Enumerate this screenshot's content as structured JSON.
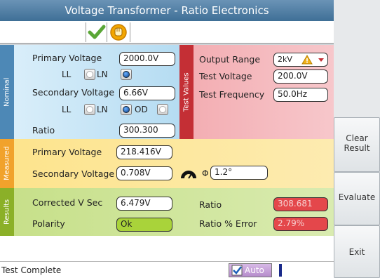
{
  "window": {
    "title": "Voltage Transformer - Ratio Electronics"
  },
  "toolbar": {
    "check_icon": "green-checkmark",
    "hand_icon": "orange-hand"
  },
  "nominal": {
    "section_label": "Nominal",
    "primary_voltage_label": "Primary Voltage",
    "primary_voltage_value": "2000.0V",
    "ll_label": "LL",
    "ln_label": "LN",
    "secondary_voltage_label": "Secondary Voltage",
    "secondary_voltage_value": "6.66V",
    "od_label": "OD",
    "ratio_label": "Ratio",
    "ratio_value": "300.300"
  },
  "test_values": {
    "section_label": "Test Values",
    "output_range_label": "Output Range",
    "output_range_value": "2kV",
    "test_voltage_label": "Test Voltage",
    "test_voltage_value": "200.0V",
    "test_frequency_label": "Test Frequency",
    "test_frequency_value": "50.0Hz"
  },
  "measured": {
    "section_label": "Measured",
    "primary_voltage_label": "Primary Voltage",
    "primary_voltage_value": "218.416V",
    "secondary_voltage_label": "Secondary Voltage",
    "secondary_voltage_value": "0.708V",
    "phi_symbol": "Φ",
    "phi_value": "1.2°"
  },
  "results": {
    "section_label": "Results",
    "corrected_v_sec_label": "Corrected V Sec",
    "corrected_v_sec_value": "6.479V",
    "polarity_label": "Polarity",
    "polarity_value": "Ok",
    "ratio_label": "Ratio",
    "ratio_value": "308.681",
    "ratio_error_label": "Ratio % Error",
    "ratio_error_value": "2.79%"
  },
  "sidebar": {
    "clear_result_label": "Clear Result",
    "evaluate_label": "Evaluate",
    "exit_label": "Exit"
  },
  "status": {
    "text": "Test Complete",
    "auto_label": "Auto",
    "auto_checked": true
  },
  "colors": {
    "title_bar": "#4f7ea4",
    "nominal_bg": "#b5dcf2",
    "test_values_bg": "#f2b6bb",
    "measured_bg": "#fde596",
    "results_bg": "#cfe59a",
    "polarity_ok": "#a9d33a",
    "error_red": "#e4474b"
  }
}
